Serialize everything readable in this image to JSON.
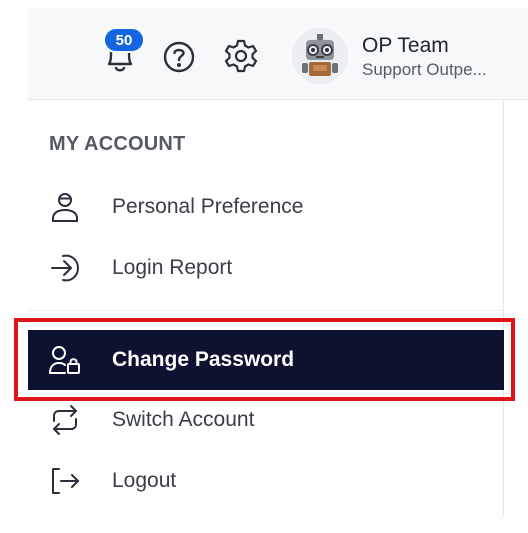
{
  "header": {
    "notification_count": "50",
    "user_name": "OP Team",
    "user_subtitle": "Support Outpe..."
  },
  "menu": {
    "heading": "MY ACCOUNT",
    "items": [
      {
        "label": "Personal Preference",
        "icon": "person-icon"
      },
      {
        "label": "Login Report",
        "icon": "login-arrow-icon"
      },
      {
        "label": "Change Password",
        "icon": "user-lock-icon",
        "active": true
      },
      {
        "label": "Switch Account",
        "icon": "switch-arrows-icon"
      },
      {
        "label": "Logout",
        "icon": "logout-icon"
      }
    ]
  },
  "colors": {
    "active_bg": "#0c1230",
    "badge": "#1565e0",
    "highlight_border": "#e0141b"
  }
}
